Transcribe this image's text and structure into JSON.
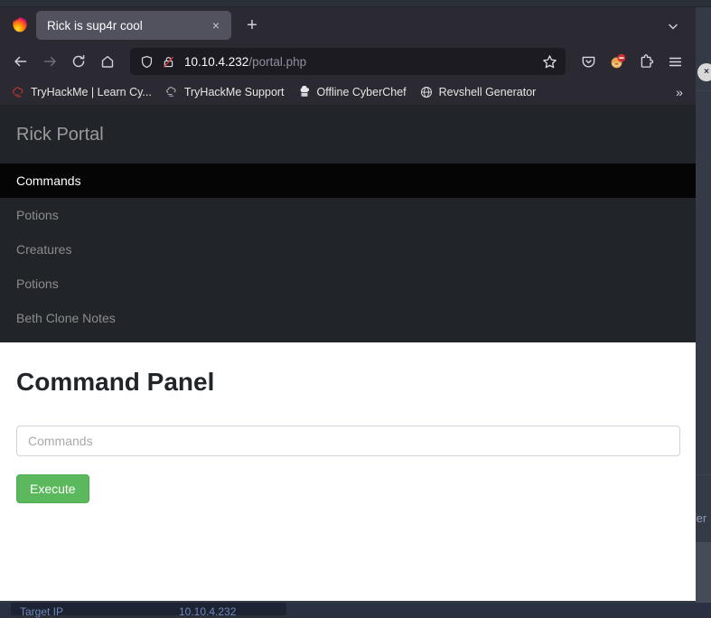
{
  "browser": {
    "tab": {
      "title": "Rick is sup4r cool",
      "close_label": "×",
      "favicon": "firefox-icon"
    },
    "newtab_label": "+",
    "tablist_label": "⌄",
    "nav": {
      "back_label": "←",
      "forward_label": "→",
      "reload_label": "⟳",
      "home_label": "⌂"
    },
    "url": {
      "host": "10.10.4.232",
      "path": "/portal.php",
      "shield_icon": "shield-icon",
      "lock_icon": "insecure-lock-icon",
      "star_icon": "bookmark-star-icon"
    },
    "toolbar_right": [
      {
        "name": "pocket-icon",
        "label": ""
      },
      {
        "name": "extension-blocker-icon",
        "label": ""
      },
      {
        "name": "extensions-puzzle-icon",
        "label": ""
      },
      {
        "name": "app-menu-icon",
        "label": "☰"
      }
    ],
    "bookmarks": [
      {
        "label": "TryHackMe | Learn Cy...",
        "icon": "tryhackme-icon"
      },
      {
        "label": "TryHackMe Support",
        "icon": "tryhackme-support-icon"
      },
      {
        "label": "Offline CyberChef",
        "icon": "cyberchef-chefhat-icon"
      },
      {
        "label": "Revshell Generator",
        "icon": "globe-icon"
      }
    ],
    "bookmarks_overflow_label": "»"
  },
  "page": {
    "site_title": "Rick Portal",
    "nav_items": [
      {
        "label": "Commands",
        "active": true
      },
      {
        "label": "Potions",
        "active": false
      },
      {
        "label": "Creatures",
        "active": false
      },
      {
        "label": "Potions",
        "active": false
      },
      {
        "label": "Beth Clone Notes",
        "active": false
      }
    ],
    "panel": {
      "title": "Command Panel",
      "input_placeholder": "Commands",
      "input_value": "",
      "execute_label": "Execute"
    }
  },
  "background": {
    "close_label": "×",
    "partial_text": "fer",
    "bottom_label": "Target IP",
    "bottom_value": "10.10.4.232"
  },
  "colors": {
    "accent_green": "#5cb85c",
    "nav_dark": "#212529",
    "nav_active": "#050505",
    "chrome_dark": "#2b2a33",
    "urlbar_dark": "#1c1b22"
  }
}
